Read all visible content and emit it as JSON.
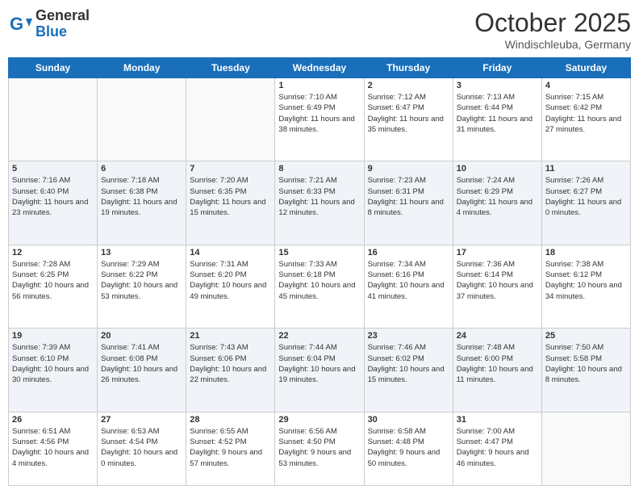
{
  "header": {
    "logo_general": "General",
    "logo_blue": "Blue",
    "month": "October 2025",
    "location": "Windischleuba, Germany"
  },
  "days_of_week": [
    "Sunday",
    "Monday",
    "Tuesday",
    "Wednesday",
    "Thursday",
    "Friday",
    "Saturday"
  ],
  "weeks": [
    [
      {
        "day": "",
        "info": ""
      },
      {
        "day": "",
        "info": ""
      },
      {
        "day": "",
        "info": ""
      },
      {
        "day": "1",
        "info": "Sunrise: 7:10 AM\nSunset: 6:49 PM\nDaylight: 11 hours and 38 minutes."
      },
      {
        "day": "2",
        "info": "Sunrise: 7:12 AM\nSunset: 6:47 PM\nDaylight: 11 hours and 35 minutes."
      },
      {
        "day": "3",
        "info": "Sunrise: 7:13 AM\nSunset: 6:44 PM\nDaylight: 11 hours and 31 minutes."
      },
      {
        "day": "4",
        "info": "Sunrise: 7:15 AM\nSunset: 6:42 PM\nDaylight: 11 hours and 27 minutes."
      }
    ],
    [
      {
        "day": "5",
        "info": "Sunrise: 7:16 AM\nSunset: 6:40 PM\nDaylight: 11 hours and 23 minutes."
      },
      {
        "day": "6",
        "info": "Sunrise: 7:18 AM\nSunset: 6:38 PM\nDaylight: 11 hours and 19 minutes."
      },
      {
        "day": "7",
        "info": "Sunrise: 7:20 AM\nSunset: 6:35 PM\nDaylight: 11 hours and 15 minutes."
      },
      {
        "day": "8",
        "info": "Sunrise: 7:21 AM\nSunset: 6:33 PM\nDaylight: 11 hours and 12 minutes."
      },
      {
        "day": "9",
        "info": "Sunrise: 7:23 AM\nSunset: 6:31 PM\nDaylight: 11 hours and 8 minutes."
      },
      {
        "day": "10",
        "info": "Sunrise: 7:24 AM\nSunset: 6:29 PM\nDaylight: 11 hours and 4 minutes."
      },
      {
        "day": "11",
        "info": "Sunrise: 7:26 AM\nSunset: 6:27 PM\nDaylight: 11 hours and 0 minutes."
      }
    ],
    [
      {
        "day": "12",
        "info": "Sunrise: 7:28 AM\nSunset: 6:25 PM\nDaylight: 10 hours and 56 minutes."
      },
      {
        "day": "13",
        "info": "Sunrise: 7:29 AM\nSunset: 6:22 PM\nDaylight: 10 hours and 53 minutes."
      },
      {
        "day": "14",
        "info": "Sunrise: 7:31 AM\nSunset: 6:20 PM\nDaylight: 10 hours and 49 minutes."
      },
      {
        "day": "15",
        "info": "Sunrise: 7:33 AM\nSunset: 6:18 PM\nDaylight: 10 hours and 45 minutes."
      },
      {
        "day": "16",
        "info": "Sunrise: 7:34 AM\nSunset: 6:16 PM\nDaylight: 10 hours and 41 minutes."
      },
      {
        "day": "17",
        "info": "Sunrise: 7:36 AM\nSunset: 6:14 PM\nDaylight: 10 hours and 37 minutes."
      },
      {
        "day": "18",
        "info": "Sunrise: 7:38 AM\nSunset: 6:12 PM\nDaylight: 10 hours and 34 minutes."
      }
    ],
    [
      {
        "day": "19",
        "info": "Sunrise: 7:39 AM\nSunset: 6:10 PM\nDaylight: 10 hours and 30 minutes."
      },
      {
        "day": "20",
        "info": "Sunrise: 7:41 AM\nSunset: 6:08 PM\nDaylight: 10 hours and 26 minutes."
      },
      {
        "day": "21",
        "info": "Sunrise: 7:43 AM\nSunset: 6:06 PM\nDaylight: 10 hours and 22 minutes."
      },
      {
        "day": "22",
        "info": "Sunrise: 7:44 AM\nSunset: 6:04 PM\nDaylight: 10 hours and 19 minutes."
      },
      {
        "day": "23",
        "info": "Sunrise: 7:46 AM\nSunset: 6:02 PM\nDaylight: 10 hours and 15 minutes."
      },
      {
        "day": "24",
        "info": "Sunrise: 7:48 AM\nSunset: 6:00 PM\nDaylight: 10 hours and 11 minutes."
      },
      {
        "day": "25",
        "info": "Sunrise: 7:50 AM\nSunset: 5:58 PM\nDaylight: 10 hours and 8 minutes."
      }
    ],
    [
      {
        "day": "26",
        "info": "Sunrise: 6:51 AM\nSunset: 4:56 PM\nDaylight: 10 hours and 4 minutes."
      },
      {
        "day": "27",
        "info": "Sunrise: 6:53 AM\nSunset: 4:54 PM\nDaylight: 10 hours and 0 minutes."
      },
      {
        "day": "28",
        "info": "Sunrise: 6:55 AM\nSunset: 4:52 PM\nDaylight: 9 hours and 57 minutes."
      },
      {
        "day": "29",
        "info": "Sunrise: 6:56 AM\nSunset: 4:50 PM\nDaylight: 9 hours and 53 minutes."
      },
      {
        "day": "30",
        "info": "Sunrise: 6:58 AM\nSunset: 4:48 PM\nDaylight: 9 hours and 50 minutes."
      },
      {
        "day": "31",
        "info": "Sunrise: 7:00 AM\nSunset: 4:47 PM\nDaylight: 9 hours and 46 minutes."
      },
      {
        "day": "",
        "info": ""
      }
    ]
  ]
}
